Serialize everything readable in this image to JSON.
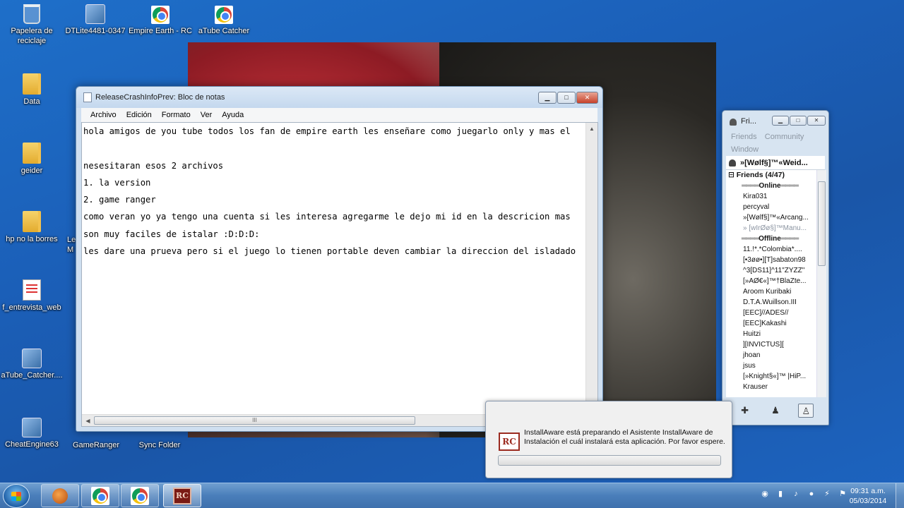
{
  "desktop": {
    "icons": [
      {
        "label": "Papelera de reciclaje",
        "icon": "recycle-bin-icon"
      },
      {
        "label": "DTLite4481-0347",
        "icon": "installer-icon"
      },
      {
        "label": "Empire Earth - RC",
        "icon": "chrome-shortcut-icon"
      },
      {
        "label": "aTube Catcher",
        "icon": "chrome-shortcut-icon"
      },
      {
        "label": "Data",
        "icon": "folder-icon"
      },
      {
        "label": "geider",
        "icon": "folder-icon"
      },
      {
        "label": "hp no la borres",
        "icon": "folder-icon"
      },
      {
        "label": "f_entrevista_web",
        "icon": "document-icon"
      },
      {
        "label": "aTube_Catcher....",
        "icon": "installer-icon"
      },
      {
        "label": "CheatEngine63",
        "icon": "installer-icon"
      },
      {
        "label": "GameRanger",
        "icon": "app-icon"
      },
      {
        "label": "Sync Folder",
        "icon": "app-icon"
      },
      {
        "label": "Le",
        "icon": "app-icon"
      },
      {
        "label": "M",
        "icon": "app-icon"
      }
    ]
  },
  "notepad": {
    "title": "ReleaseCrashInfoPrev: Bloc de notas",
    "menu": [
      "Archivo",
      "Edición",
      "Formato",
      "Ver",
      "Ayuda"
    ],
    "content": "hola amigos de you tube todos los fan de empire earth les enseñare como juegarlo only y mas el\n\nnesesitaran esos 2 archivos\n1. la version\n2. game ranger\ncomo veran yo ya tengo una cuenta si les interesa agregarme le dejo mi id en la descricion mas\nson muy faciles de istalar :D:D:D:\nles dare una prueva pero si el juego lo tienen portable deven cambiar la direccion del isladado",
    "hscroll_grip": "III",
    "buttons": {
      "minimize": "▁",
      "maximize": "□",
      "close": "✕"
    }
  },
  "friends": {
    "title": "Fri...",
    "menu": [
      "Friends",
      "Community",
      "Window"
    ],
    "user": "»[Wølf§]™«Weid...",
    "group": "Friends (4/47)",
    "online_header": "Online",
    "online": [
      {
        "name": "Kira031",
        "away": false
      },
      {
        "name": "percyval",
        "away": false
      },
      {
        "name": "»[Wølf§]™«Arcang...",
        "away": false
      },
      {
        "name": "» [wIrØø§]™Manu...",
        "away": true
      }
    ],
    "offline_header": "Offline",
    "offline": [
      "11.!*.*Colombia*....",
      "[•3øø•][T]sabaton98",
      "^3[DS11]^11\"ZYZZ\"",
      "[»AØ€«]™†BlaZte...",
      "Aroom Kuribaki",
      "D.T.A.Wuillson.III",
      "[EEC]//ADES//",
      "[EEC]Kakashi",
      "Huitzi",
      "][INVICTUS][",
      "jhoan",
      "jsus",
      "[»Knight§«]™ |HiP...",
      "Krauser"
    ],
    "buttons": {
      "minimize": "▁",
      "maximize": "□",
      "close": "✕"
    }
  },
  "install_dialog": {
    "message": "InstallAware está preparando el Asistente InstallAware de Instalación el cuál instalará esta aplicación. Por favor espere.",
    "logo": "RC"
  },
  "taskbar": {
    "clock_time": "09:31 a.m.",
    "clock_date": "05/03/2014",
    "rc_label": "RC"
  },
  "colors": {
    "desktop_blue": "#1b5fb8",
    "taskbar_blue": "#4a7eba"
  }
}
